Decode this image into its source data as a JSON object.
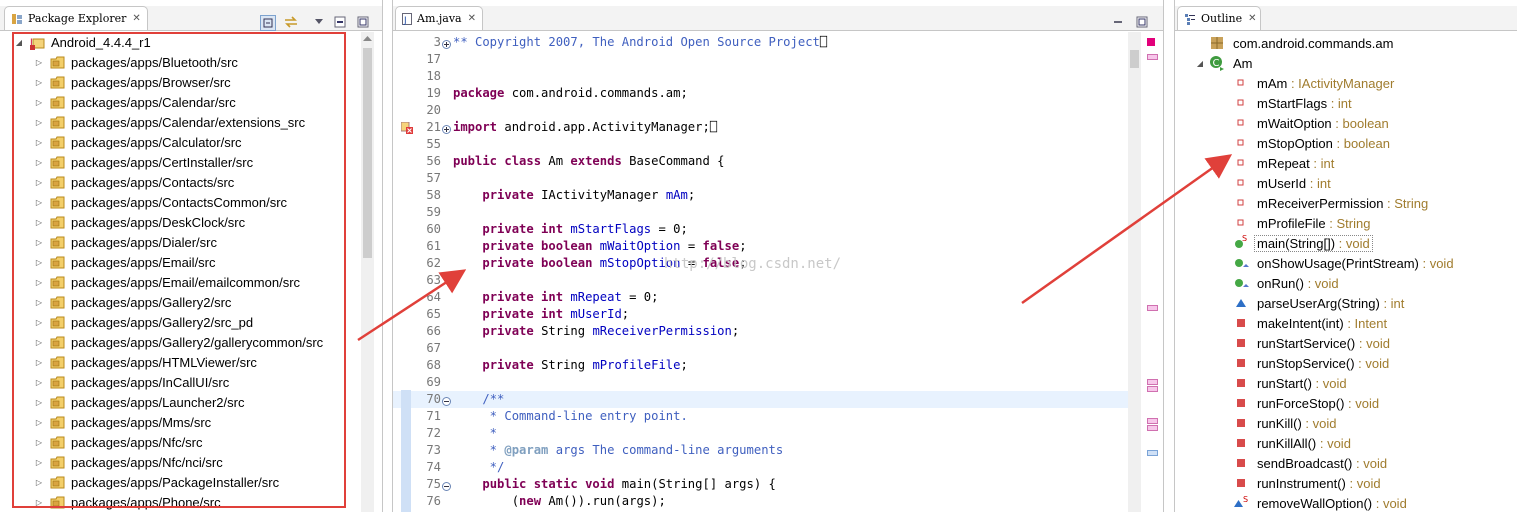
{
  "colors": {
    "highlight_box": "#e0403a",
    "keyword": "#7f0055",
    "field": "#0000c0",
    "javadoc": "#3f5fbf",
    "comment": "#3f7f5f",
    "outline_type": "#a07c2e"
  },
  "package_explorer": {
    "tab_title": "Package Explorer",
    "project": "Android_4.4.4_r1",
    "packages": [
      "packages/apps/Bluetooth/src",
      "packages/apps/Browser/src",
      "packages/apps/Calendar/src",
      "packages/apps/Calendar/extensions_src",
      "packages/apps/Calculator/src",
      "packages/apps/CertInstaller/src",
      "packages/apps/Contacts/src",
      "packages/apps/ContactsCommon/src",
      "packages/apps/DeskClock/src",
      "packages/apps/Dialer/src",
      "packages/apps/Email/src",
      "packages/apps/Email/emailcommon/src",
      "packages/apps/Gallery2/src",
      "packages/apps/Gallery2/src_pd",
      "packages/apps/Gallery2/gallerycommon/src",
      "packages/apps/HTMLViewer/src",
      "packages/apps/InCallUI/src",
      "packages/apps/Launcher2/src",
      "packages/apps/Mms/src",
      "packages/apps/Nfc/src",
      "packages/apps/Nfc/nci/src",
      "packages/apps/PackageInstaller/src",
      "packages/apps/Phone/src"
    ]
  },
  "editor": {
    "tab_title": "Am.java",
    "watermark": "http://blog.csdn.net/",
    "lines": [
      {
        "n": "3",
        "fold": "plus",
        "html": "<span class=\"jd\">** Copyright 2007, The Android Open Source Project</span>&#x2395;"
      },
      {
        "n": "17",
        "html": ""
      },
      {
        "n": "18",
        "html": ""
      },
      {
        "n": "19",
        "html": "<span class=\"kw\">package</span> com.android.commands.am;"
      },
      {
        "n": "20",
        "html": ""
      },
      {
        "n": "21",
        "fold": "plus",
        "error": true,
        "html": "<span class=\"kw\">import</span> android.app.ActivityManager;&#x2395;"
      },
      {
        "n": "55",
        "html": ""
      },
      {
        "n": "56",
        "html": "<span class=\"kw\">public class</span> Am <span class=\"kw\">extends</span> BaseCommand {"
      },
      {
        "n": "57",
        "html": ""
      },
      {
        "n": "58",
        "html": "    <span class=\"kw\">private</span> IActivityManager <span class=\"fld\">mAm</span>;"
      },
      {
        "n": "59",
        "html": ""
      },
      {
        "n": "60",
        "html": "    <span class=\"kw\">private int</span> <span class=\"fld\">mStartFlags</span> = 0;"
      },
      {
        "n": "61",
        "html": "    <span class=\"kw\">private boolean</span> <span class=\"fld\">mWaitOption</span> = <span class=\"kw\">false</span>;"
      },
      {
        "n": "62",
        "html": "    <span class=\"kw\">private boolean</span> <span class=\"fld\">mStopOption</span> = <span class=\"kw\">false</span>;"
      },
      {
        "n": "63",
        "html": ""
      },
      {
        "n": "64",
        "html": "    <span class=\"kw\">private int</span> <span class=\"fld\">mRepeat</span> = 0;"
      },
      {
        "n": "65",
        "html": "    <span class=\"kw\">private int</span> <span class=\"fld\">mUserId</span>;"
      },
      {
        "n": "66",
        "html": "    <span class=\"kw\">private</span> String <span class=\"fld\">mReceiverPermission</span>;"
      },
      {
        "n": "67",
        "html": ""
      },
      {
        "n": "68",
        "html": "    <span class=\"kw\">private</span> String <span class=\"fld\">mProfileFile</span>;"
      },
      {
        "n": "69",
        "html": ""
      },
      {
        "n": "70",
        "fold": "minus",
        "hl": true,
        "html": "    <span class=\"jd\">/**</span>"
      },
      {
        "n": "71",
        "html": "<span class=\"jd\">     * Command-line entry point.</span>"
      },
      {
        "n": "72",
        "html": "<span class=\"jd\">     *</span>"
      },
      {
        "n": "73",
        "html": "<span class=\"jd\">     * </span><span class=\"jdt\">@param</span><span class=\"jd\"> args The command-line arguments</span>"
      },
      {
        "n": "74",
        "html": "<span class=\"jd\">     */</span>"
      },
      {
        "n": "75",
        "fold": "minus",
        "html": "    <span class=\"kw\">public static void</span> main(String[] args) {"
      },
      {
        "n": "76",
        "html": "        (<span class=\"kw\">new</span> Am()).run(args);"
      }
    ]
  },
  "outline": {
    "tab_title": "Outline",
    "items": [
      {
        "kind": "package",
        "name": "com.android.commands.am",
        "type": "",
        "indent": 0,
        "tw": ""
      },
      {
        "kind": "class",
        "name": "Am",
        "type": "",
        "indent": 0,
        "tw": "expanded"
      },
      {
        "kind": "field",
        "name": "mAm",
        "type": " : IActivityManager",
        "indent": 1
      },
      {
        "kind": "field",
        "name": "mStartFlags",
        "type": " : int",
        "indent": 1
      },
      {
        "kind": "field",
        "name": "mWaitOption",
        "type": " : boolean",
        "indent": 1
      },
      {
        "kind": "field",
        "name": "mStopOption",
        "type": " : boolean",
        "indent": 1
      },
      {
        "kind": "field",
        "name": "mRepeat",
        "type": " : int",
        "indent": 1
      },
      {
        "kind": "field",
        "name": "mUserId",
        "type": " : int",
        "indent": 1
      },
      {
        "kind": "field",
        "name": "mReceiverPermission",
        "type": " : String",
        "indent": 1
      },
      {
        "kind": "field",
        "name": "mProfileFile",
        "type": " : String",
        "indent": 1
      },
      {
        "kind": "public-static",
        "name": "main(String[])",
        "type": " : void",
        "indent": 1,
        "selected": true
      },
      {
        "kind": "public-override",
        "name": "onShowUsage(PrintStream)",
        "type": " : void",
        "indent": 1
      },
      {
        "kind": "public-override",
        "name": "onRun()",
        "type": " : void",
        "indent": 1
      },
      {
        "kind": "protected",
        "name": "parseUserArg(String)",
        "type": " : int",
        "indent": 1
      },
      {
        "kind": "private",
        "name": "makeIntent(int)",
        "type": " : Intent",
        "indent": 1
      },
      {
        "kind": "private",
        "name": "runStartService()",
        "type": " : void",
        "indent": 1
      },
      {
        "kind": "private",
        "name": "runStopService()",
        "type": " : void",
        "indent": 1
      },
      {
        "kind": "private",
        "name": "runStart()",
        "type": " : void",
        "indent": 1
      },
      {
        "kind": "private",
        "name": "runForceStop()",
        "type": " : void",
        "indent": 1
      },
      {
        "kind": "private",
        "name": "runKill()",
        "type": " : void",
        "indent": 1
      },
      {
        "kind": "private",
        "name": "runKillAll()",
        "type": " : void",
        "indent": 1
      },
      {
        "kind": "private",
        "name": "sendBroadcast()",
        "type": " : void",
        "indent": 1
      },
      {
        "kind": "private",
        "name": "runInstrument()",
        "type": " : void",
        "indent": 1
      },
      {
        "kind": "protected-static",
        "name": "removeWallOption()",
        "type": " : void",
        "indent": 1
      }
    ]
  }
}
